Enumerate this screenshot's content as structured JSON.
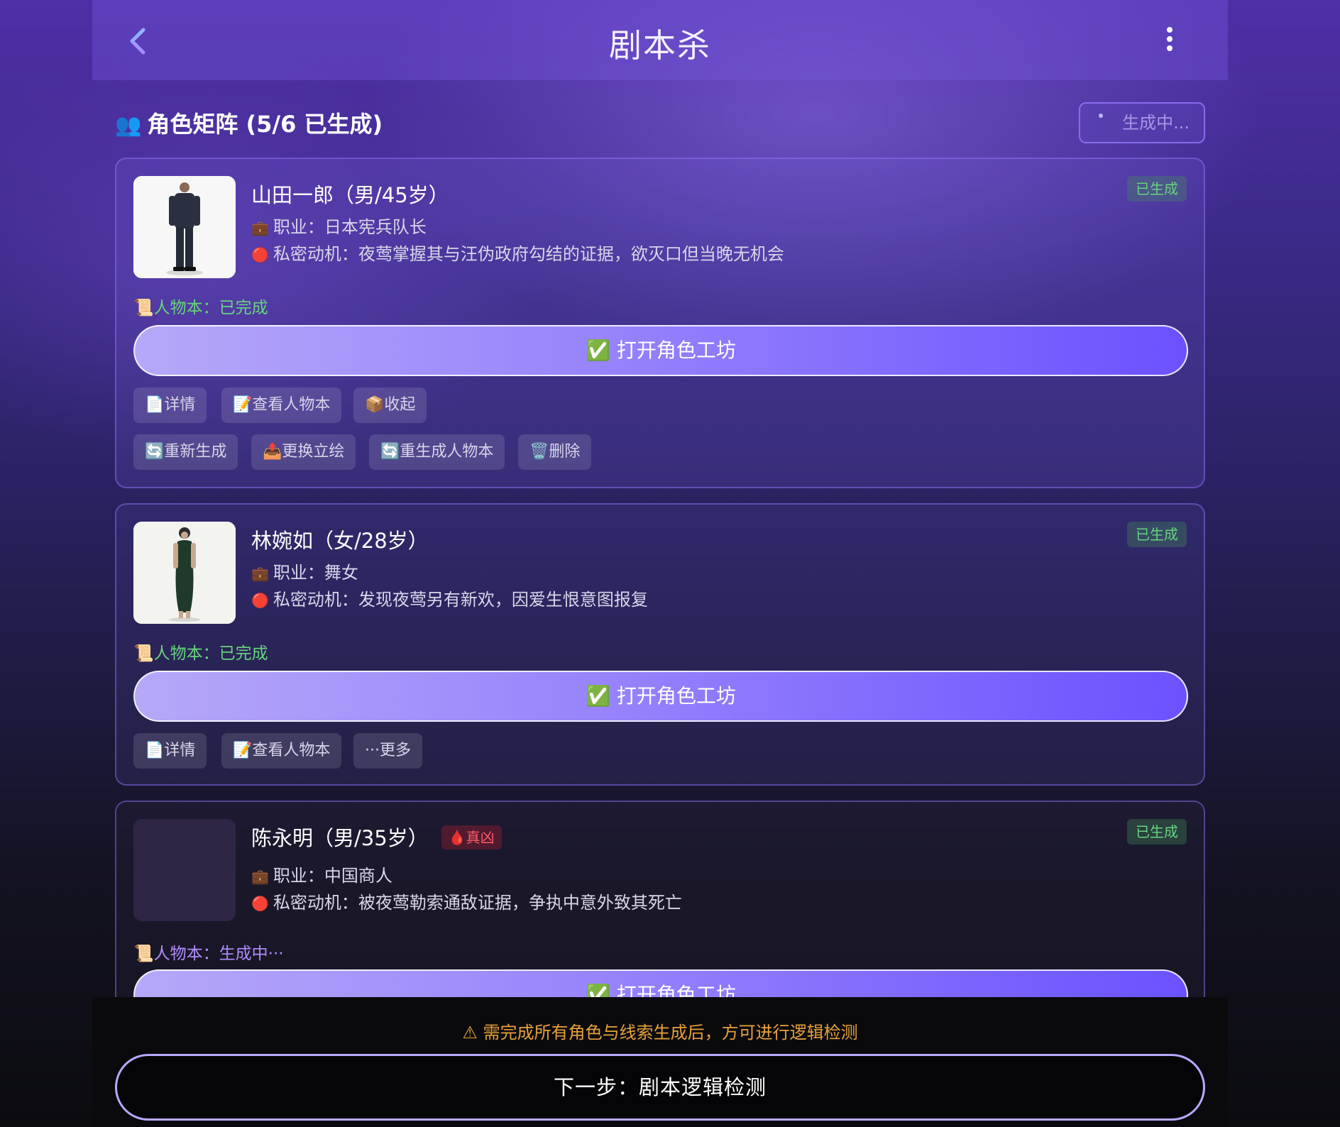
{
  "header": {
    "title": "剧本杀"
  },
  "section": {
    "icon": "👥",
    "title": "角色矩阵 (5/6 已生成)",
    "generate_label": "生成中..."
  },
  "characters": [
    {
      "name": "山田一郎（男/45岁）",
      "badge": "",
      "status": "已生成",
      "occupation_icon": "💼",
      "occupation": "职业：日本宪兵队长",
      "motive_icon": "🔴",
      "motive": "私密动机：夜莺掌握其与汪伪政府勾结的证据，欲灭口但当晚无机会",
      "script_icon": "📜",
      "script_status": "人物本：已完成",
      "open_label": "✅ 打开角色工坊",
      "actions_row1": [
        "📄详情",
        "📝查看人物本",
        "📦收起"
      ],
      "actions_row2": [
        "🔄重新生成",
        "📤更换立绘",
        "🔄重生成人物本",
        "🗑️删除"
      ]
    },
    {
      "name": "林婉如（女/28岁）",
      "badge": "",
      "status": "已生成",
      "occupation_icon": "💼",
      "occupation": "职业：舞女",
      "motive_icon": "🔴",
      "motive": "私密动机：发现夜莺另有新欢，因爱生恨意图报复",
      "script_icon": "📜",
      "script_status": "人物本：已完成",
      "open_label": "✅ 打开角色工坊",
      "actions_row1": [
        "📄详情",
        "📝查看人物本",
        "···更多"
      ]
    },
    {
      "name": "陈永明（男/35岁）",
      "badge": "🩸真凶",
      "status": "已生成",
      "occupation_icon": "💼",
      "occupation": "职业：中国商人",
      "motive_icon": "🔴",
      "motive": "私密动机：被夜莺勒索通敌证据，争执中意外致其死亡",
      "script_icon": "📜",
      "script_status": "人物本：生成中···",
      "open_label": "✅ 打开角色工坊"
    }
  ],
  "footer": {
    "warning": "⚠ 需完成所有角色与线索生成后，方可进行逻辑检测",
    "next_label": "下一步：剧本逻辑检测"
  },
  "colors": {
    "accent": "#6a52ff",
    "done": "#66d47c",
    "warning": "#e7a13a",
    "culprit": "#ff5b66"
  }
}
